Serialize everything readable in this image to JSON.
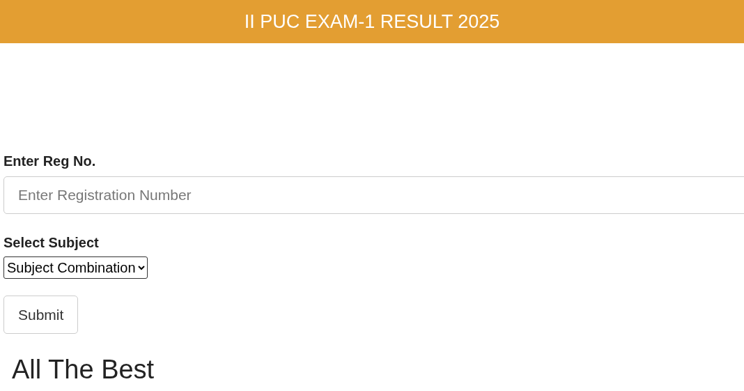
{
  "header": {
    "title": "II PUC EXAM-1 RESULT 2025"
  },
  "form": {
    "reg_label": "Enter Reg No.",
    "reg_field": {
      "placeholder": "Enter Registration Number"
    },
    "subject_label": "Select Subject",
    "subject_select": {
      "value": "Subject Combination"
    },
    "submit": "Submit"
  },
  "footer_text": "All The Best"
}
